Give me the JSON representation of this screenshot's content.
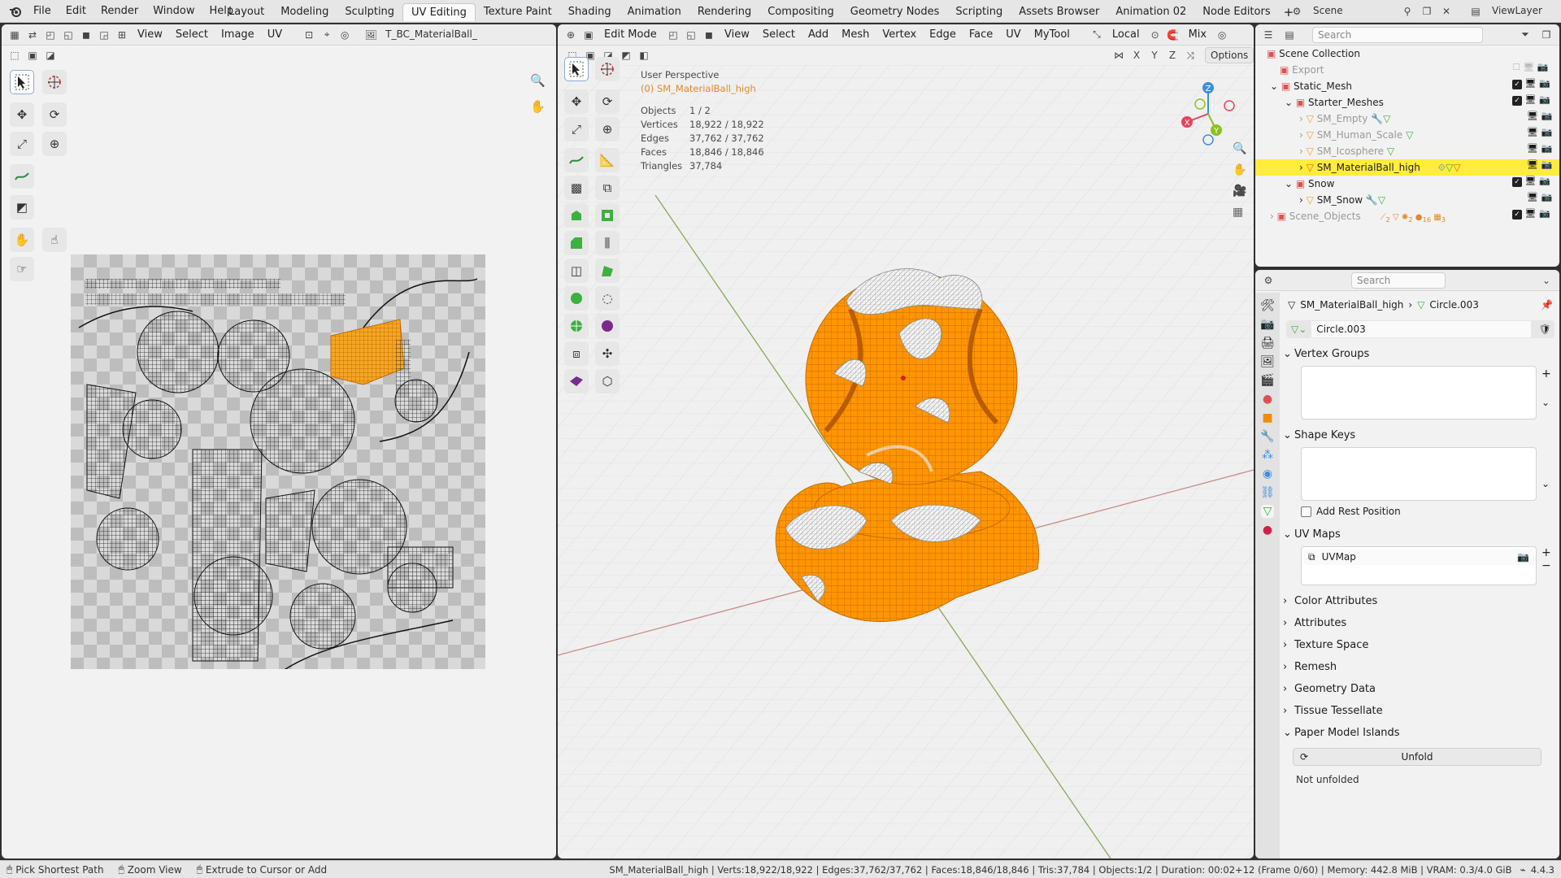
{
  "menu": {
    "items": [
      "File",
      "Edit",
      "Render",
      "Window",
      "Help"
    ]
  },
  "workspaces": [
    "Layout",
    "Modeling",
    "Sculpting",
    "UV Editing",
    "Texture Paint",
    "Shading",
    "Animation",
    "Rendering",
    "Compositing",
    "Geometry Nodes",
    "Scripting",
    "Assets Browser",
    "Animation 02",
    "Node Editors"
  ],
  "active_workspace": "UV Editing",
  "scene": {
    "name": "Scene",
    "view_layer": "ViewLayer"
  },
  "uv_editor": {
    "menus": [
      "View",
      "Select",
      "Image",
      "UV"
    ],
    "image_name": "T_BC_MaterialBall_Pain"
  },
  "viewport": {
    "mode": "Edit Mode",
    "menus": [
      "View",
      "Select",
      "Add",
      "Mesh",
      "Vertex",
      "Edge",
      "Face",
      "UV",
      "MyTool"
    ],
    "transform_orientation": "Local",
    "snap_mode": "Mix",
    "axes": [
      "X",
      "Y",
      "Z"
    ],
    "options_label": "Options",
    "perspective": "User Perspective",
    "object_line": "(0) SM_MaterialBall_high",
    "stats": [
      {
        "label": "Objects",
        "value": "1 / 2"
      },
      {
        "label": "Vertices",
        "value": "18,922 / 18,922"
      },
      {
        "label": "Edges",
        "value": "37,762 / 37,762"
      },
      {
        "label": "Faces",
        "value": "18,846 / 18,846"
      },
      {
        "label": "Triangles",
        "value": "37,784"
      }
    ],
    "gizmo": {
      "x": "X",
      "y": "Y",
      "z": "Z"
    }
  },
  "outliner": {
    "search_placeholder": "Search",
    "root": "Scene Collection",
    "rows": [
      {
        "label": "Export",
        "dim": true
      },
      {
        "label": "Static_Mesh"
      },
      {
        "label": "Starter_Meshes"
      },
      {
        "label": "SM_Empty",
        "dim": true
      },
      {
        "label": "SM_Human_Scale",
        "dim": true
      },
      {
        "label": "SM_Icosphere",
        "dim": true
      },
      {
        "label": "SM_MaterialBall_high",
        "active": true
      },
      {
        "label": "Snow"
      },
      {
        "label": "SM_Snow"
      },
      {
        "label": "Scene_Objects",
        "dim": true
      }
    ],
    "scene_objects_counts": [
      "2",
      "2",
      "16",
      "3"
    ]
  },
  "properties": {
    "search_placeholder": "Search",
    "breadcrumb_object": "SM_MaterialBall_high",
    "breadcrumb_mesh": "Circle.003",
    "mesh_name": "Circle.003",
    "sections": {
      "vertex_groups": "Vertex Groups",
      "shape_keys": "Shape Keys",
      "add_rest_position": "Add Rest Position",
      "uv_maps": "UV Maps",
      "uv_map_item": "UVMap",
      "color_attributes": "Color Attributes",
      "attributes": "Attributes",
      "texture_space": "Texture Space",
      "remesh": "Remesh",
      "geometry_data": "Geometry Data",
      "tissue_tessellate": "Tissue Tessellate",
      "paper_model_islands": "Paper Model Islands",
      "unfold": "Unfold",
      "not_unfolded": "Not unfolded"
    }
  },
  "statusbar": {
    "hints": [
      "Pick Shortest Path",
      "Zoom View",
      "Extrude to Cursor or Add"
    ],
    "info": "SM_MaterialBall_high | Verts:18,922/18,922 | Edges:37,762/37,762 | Faces:18,846/18,846 | Tris:37,784 | Objects:1/2 | Duration: 00:02+12 (Frame 0/60) | Memory: 442.8 MiB | VRAM: 0.3/4.0 GiB",
    "version": "4.4.3"
  },
  "colors": {
    "accent": "#ff8c00",
    "highlight": "#ffec3d",
    "active_tab": "#fafafa",
    "x_axis": "#e8415a",
    "y_axis": "#8cc220",
    "z_axis": "#3a8fe0"
  }
}
